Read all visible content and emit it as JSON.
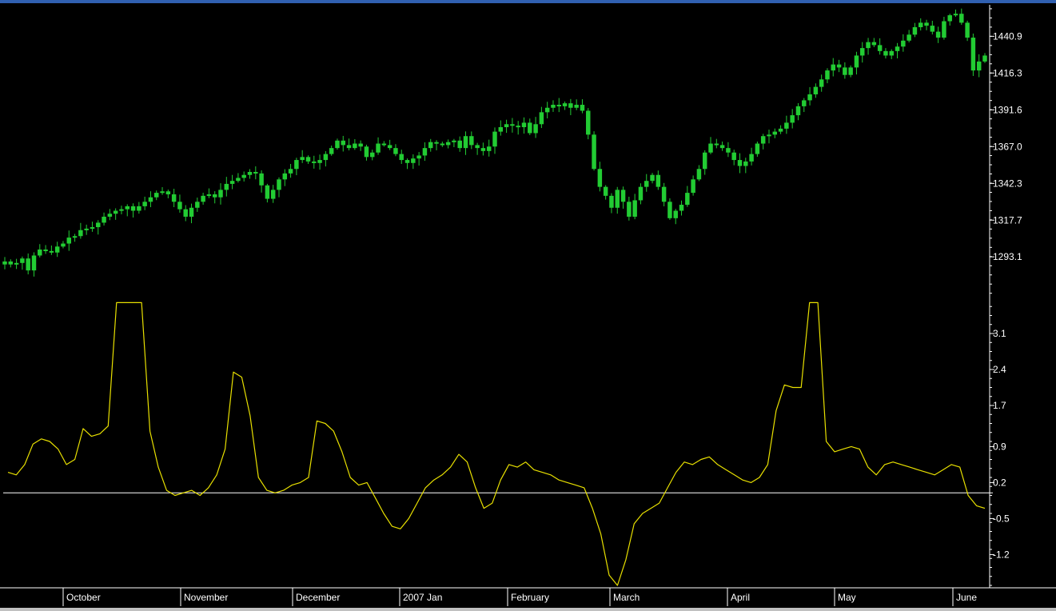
{
  "colors": {
    "background": "#000000",
    "candle_up": "#22cc33",
    "candle_wick": "#22cc33",
    "indicator_line": "#e8e000",
    "zero_line": "#ffffff",
    "axis": "#ffffff",
    "text": "#ffffff",
    "window_chrome": "#3060b0"
  },
  "chart_data": [
    {
      "type": "candlestick",
      "title": "",
      "xlabel": "",
      "ylabel": "",
      "y_ticks": [
        "1440.9",
        "1416.3",
        "1391.6",
        "1367.0",
        "1342.3",
        "1317.7",
        "1293.1"
      ],
      "y_tick_values": [
        1440.9,
        1416.3,
        1391.6,
        1367.0,
        1342.3,
        1317.7,
        1293.1
      ],
      "ylim": [
        1268.0,
        1462.0
      ],
      "x_categories": [
        "October",
        "November",
        "December",
        "2007 Jan",
        "February",
        "March",
        "April",
        "May",
        "June"
      ],
      "close_values": [
        1290,
        1288,
        1289,
        1292,
        1284,
        1294,
        1298,
        1297,
        1296,
        1300,
        1302,
        1306,
        1307,
        1311,
        1312,
        1313,
        1316,
        1320,
        1322,
        1324,
        1325,
        1327,
        1324,
        1327,
        1330,
        1333,
        1336,
        1337,
        1335,
        1330,
        1325,
        1320,
        1326,
        1330,
        1334,
        1335,
        1333,
        1338,
        1342,
        1344,
        1346,
        1348,
        1350,
        1349,
        1341,
        1332,
        1338,
        1345,
        1349,
        1352,
        1358,
        1360,
        1357,
        1356,
        1358,
        1362,
        1366,
        1371,
        1368,
        1366,
        1369,
        1367,
        1360,
        1363,
        1369,
        1368,
        1366,
        1362,
        1358,
        1356,
        1359,
        1361,
        1366,
        1370,
        1369,
        1368,
        1370,
        1371,
        1366,
        1374,
        1368,
        1366,
        1364,
        1367,
        1377,
        1380,
        1382,
        1381,
        1380,
        1383,
        1376,
        1382,
        1390,
        1393,
        1395,
        1394,
        1396,
        1393,
        1395,
        1391,
        1375,
        1352,
        1340,
        1334,
        1326,
        1338,
        1330,
        1320,
        1331,
        1340,
        1344,
        1348,
        1340,
        1330,
        1319,
        1324,
        1328,
        1336,
        1345,
        1352,
        1363,
        1369,
        1368,
        1366,
        1363,
        1358,
        1354,
        1357,
        1362,
        1369,
        1374,
        1375,
        1377,
        1379,
        1383,
        1388,
        1394,
        1398,
        1402,
        1407,
        1412,
        1418,
        1422,
        1420,
        1415,
        1420,
        1428,
        1433,
        1437,
        1435,
        1431,
        1428,
        1431,
        1434,
        1438,
        1442,
        1447,
        1450,
        1448,
        1444,
        1440,
        1451,
        1455,
        1456,
        1450,
        1440,
        1418,
        1424,
        1428
      ],
      "series_name": ""
    },
    {
      "type": "line",
      "title": "",
      "xlabel": "",
      "ylabel": "",
      "y_ticks": [
        "3.1",
        "2.4",
        "1.7",
        "0.9",
        "0.2",
        "-0.5",
        "-1.2"
      ],
      "y_tick_values": [
        3.1,
        2.4,
        1.7,
        0.9,
        0.2,
        -0.5,
        -1.2
      ],
      "ylim": [
        -1.8,
        3.8
      ],
      "zero_line_value": 0.0,
      "x_categories": [
        "October",
        "November",
        "December",
        "2007 Jan",
        "February",
        "March",
        "April",
        "May",
        "June"
      ],
      "values": [
        0.4,
        0.35,
        0.55,
        0.95,
        1.05,
        1.0,
        0.85,
        0.55,
        0.65,
        1.25,
        1.1,
        1.15,
        1.3,
        3.7,
        3.7,
        3.7,
        3.7,
        1.2,
        0.5,
        0.05,
        -0.05,
        0.0,
        0.05,
        -0.05,
        0.1,
        0.35,
        0.85,
        2.35,
        2.25,
        1.5,
        0.3,
        0.05,
        0.0,
        0.05,
        0.15,
        0.2,
        0.3,
        1.4,
        1.35,
        1.2,
        0.8,
        0.3,
        0.15,
        0.2,
        -0.1,
        -0.4,
        -0.65,
        -0.7,
        -0.5,
        -0.2,
        0.1,
        0.25,
        0.35,
        0.5,
        0.75,
        0.6,
        0.1,
        -0.3,
        -0.2,
        0.25,
        0.55,
        0.5,
        0.6,
        0.45,
        0.4,
        0.35,
        0.25,
        0.2,
        0.15,
        0.1,
        -0.3,
        -0.8,
        -1.6,
        -1.8,
        -1.3,
        -0.6,
        -0.4,
        -0.3,
        -0.2,
        0.1,
        0.4,
        0.6,
        0.55,
        0.65,
        0.7,
        0.55,
        0.45,
        0.35,
        0.25,
        0.2,
        0.3,
        0.55,
        1.6,
        2.1,
        2.05,
        2.05,
        3.7,
        3.7,
        1.0,
        0.8,
        0.85,
        0.9,
        0.85,
        0.5,
        0.35,
        0.55,
        0.6,
        0.55,
        0.5,
        0.45,
        0.4,
        0.35,
        0.45,
        0.55,
        0.5,
        -0.05,
        -0.25,
        -0.3
      ],
      "series_name": ""
    }
  ],
  "x_axis": {
    "months": [
      "October",
      "November",
      "December",
      "2007 Jan",
      "February",
      "March",
      "April",
      "May",
      "June"
    ]
  }
}
